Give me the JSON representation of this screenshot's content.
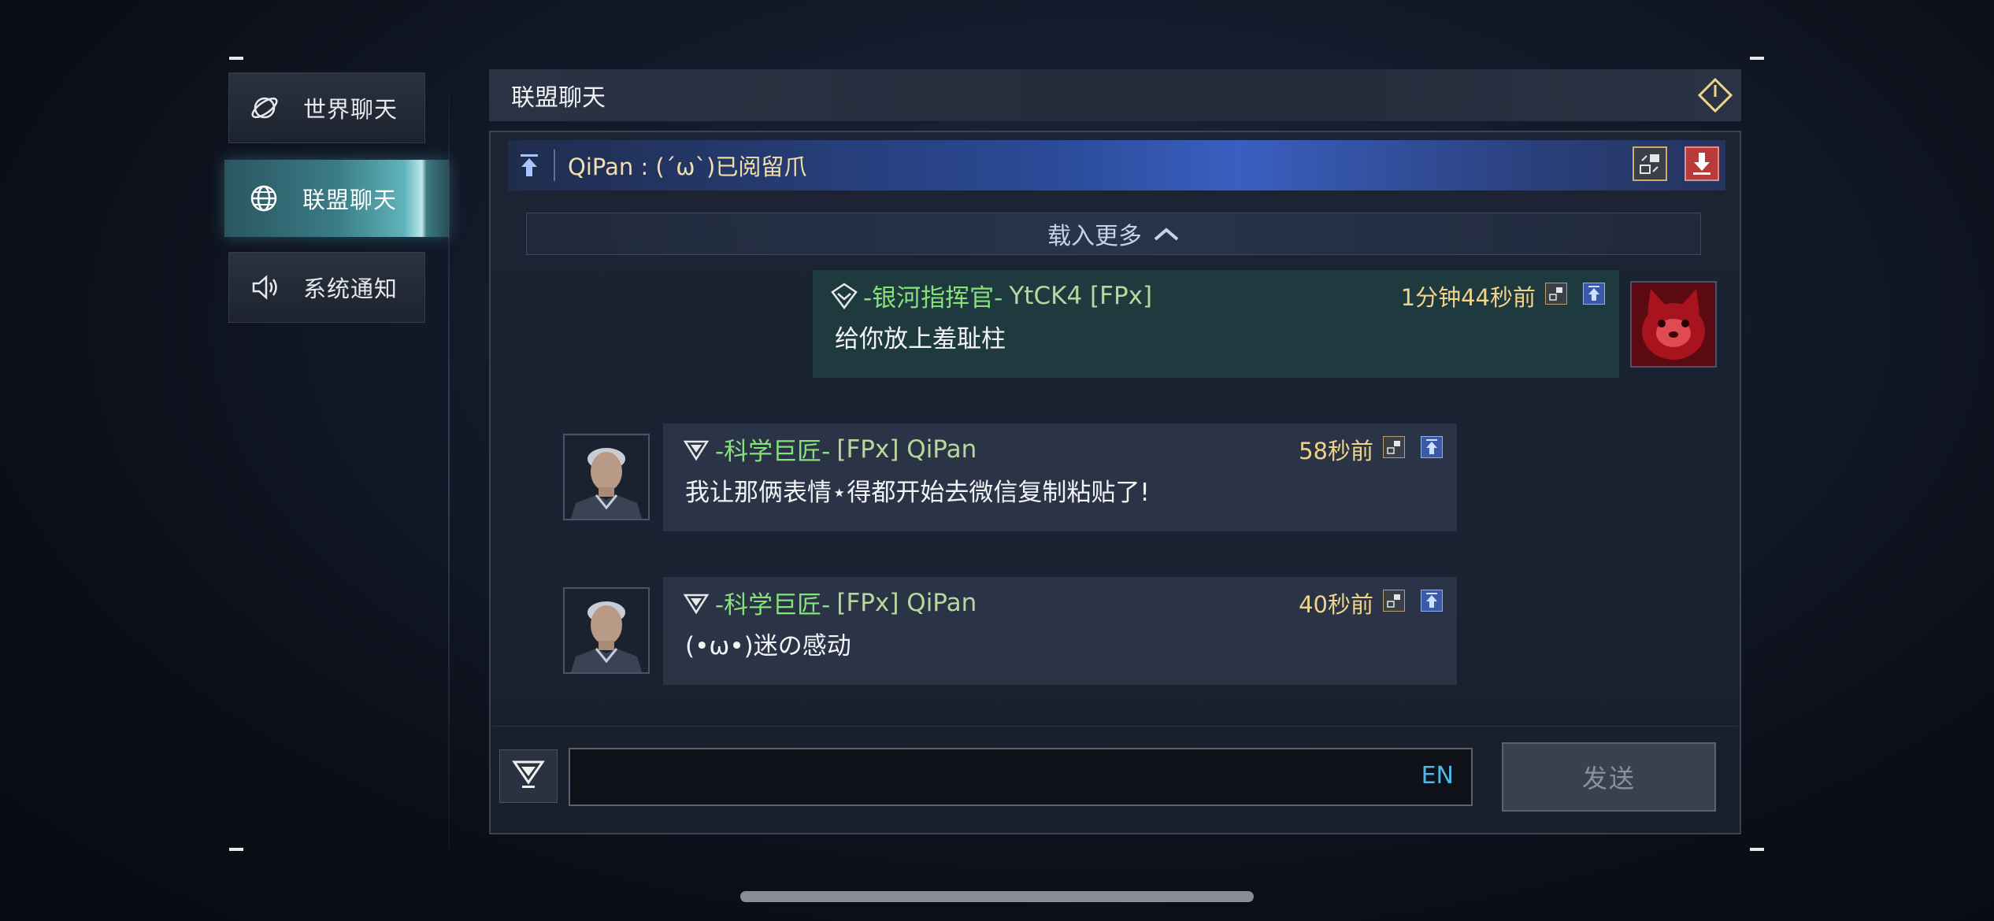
{
  "sidebar": {
    "items": [
      {
        "label": "世界聊天",
        "icon": "planet-icon",
        "active": false
      },
      {
        "label": "联盟聊天",
        "icon": "globe-icon",
        "active": true
      },
      {
        "label": "系统通知",
        "icon": "speaker-icon",
        "active": false
      }
    ]
  },
  "header": {
    "title": "联盟聊天",
    "exit_icon": "exit-diamond-icon"
  },
  "pinned": {
    "text": "QiPan : (´ω`)已阅留爪"
  },
  "load_more": {
    "label": "载入更多",
    "icon": "chevron-up-icon"
  },
  "messages": [
    {
      "self": true,
      "title": "-银河指挥官-",
      "name": "YtCK4 [FPx]",
      "time": "1分钟44秒前",
      "text": "给你放上羞耻柱",
      "avatar": "red-cat-avatar"
    },
    {
      "self": false,
      "title": "-科学巨匠-",
      "name": "[FPx] QiPan",
      "time": "58秒前",
      "text": "我让那俩表情⋆得都开始去微信复制粘贴了!",
      "avatar": "commander-avatar"
    },
    {
      "self": false,
      "title": "-科学巨匠-",
      "name": "[FPx] QiPan",
      "time": "40秒前",
      "text": "(•ω•)迷の感动",
      "avatar": "commander-avatar"
    }
  ],
  "input": {
    "lang": "EN",
    "value": ""
  },
  "send_label": "发送",
  "colors": {
    "accent_title": "#86e07c",
    "time": "#f0d48a",
    "pinned_text": "#f5dfa8",
    "lang": "#4fb6e8"
  }
}
